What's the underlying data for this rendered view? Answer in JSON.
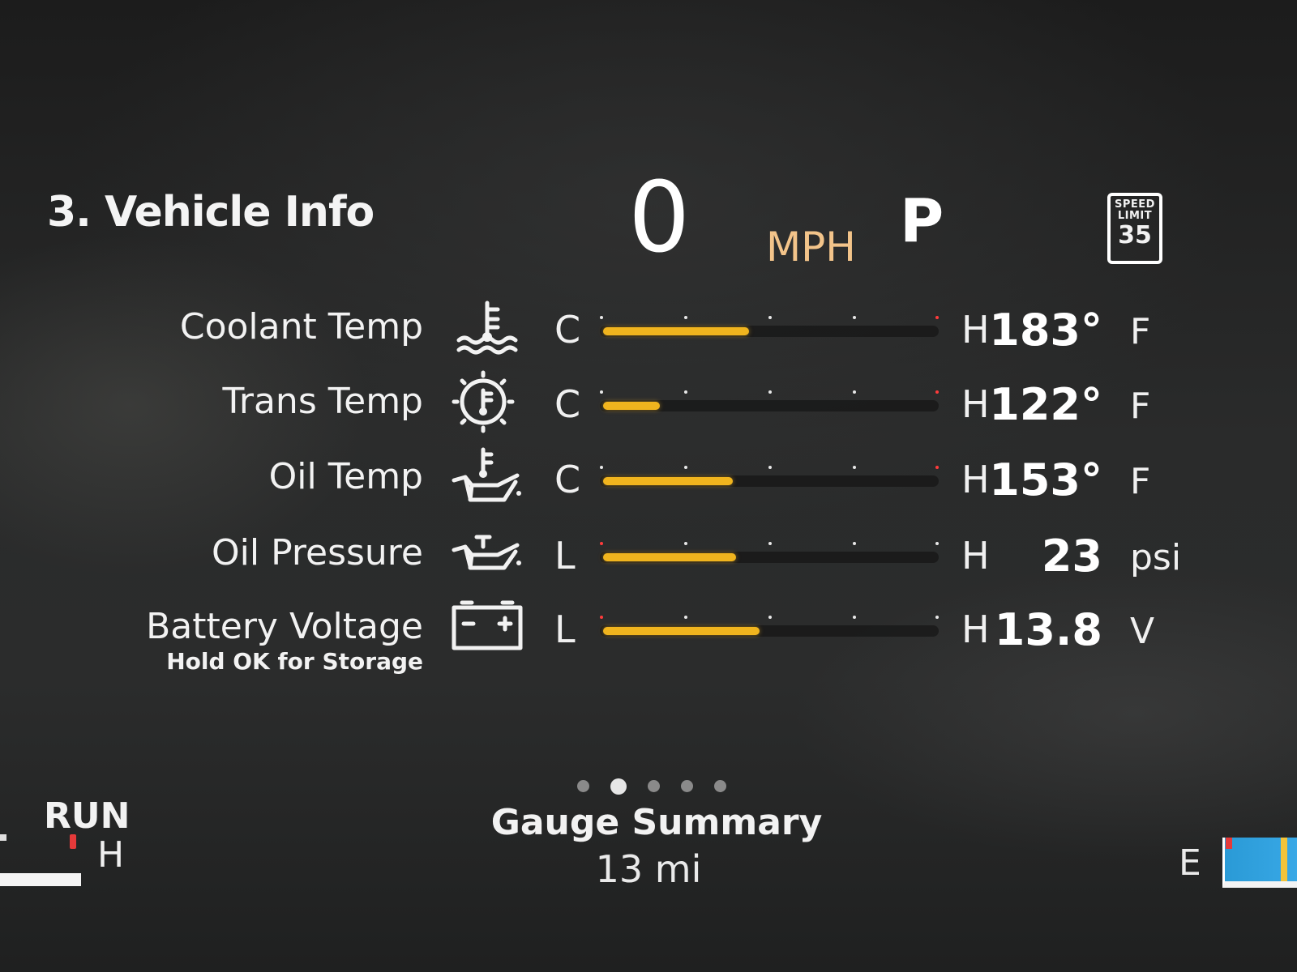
{
  "header": {
    "title": "3. Vehicle Info",
    "speed": "0",
    "speed_unit": "MPH",
    "gear": "P",
    "speed_limit": {
      "label_line1": "SPEED",
      "label_line2": "LIMIT",
      "value": "35"
    }
  },
  "gauges": [
    {
      "label": "Coolant Temp",
      "low": "C",
      "high": "H",
      "value": "183°",
      "unit": "F",
      "fill": 0.44,
      "icon": "coolant-temp-icon"
    },
    {
      "label": "Trans Temp",
      "low": "C",
      "high": "H",
      "value": "122°",
      "unit": "F",
      "fill": 0.17,
      "icon": "trans-temp-icon"
    },
    {
      "label": "Oil Temp",
      "low": "C",
      "high": "H",
      "value": "153°",
      "unit": "F",
      "fill": 0.39,
      "icon": "oil-temp-icon"
    },
    {
      "label": "Oil Pressure",
      "low": "L",
      "high": "H",
      "value": "23",
      "unit": "psi",
      "fill": 0.4,
      "icon": "oil-pressure-icon"
    },
    {
      "label": "Battery Voltage",
      "sublabel": "Hold OK for Storage",
      "low": "L",
      "high": "H",
      "value": "13.8",
      "unit": "V",
      "fill": 0.47,
      "icon": "battery-icon"
    }
  ],
  "pager": {
    "count": 5,
    "active_index": 1
  },
  "footer": {
    "page_name": "Gauge Summary",
    "trip": "13 mi",
    "run_label": "RUN",
    "temp_high": "H",
    "fuel_empty": "E"
  },
  "colors": {
    "gauge_fill": "#f0b41e",
    "unit_accent": "#f3c48a",
    "warning_tick": "#ff3b3b",
    "fuel_blue": "#2a9ad6"
  }
}
